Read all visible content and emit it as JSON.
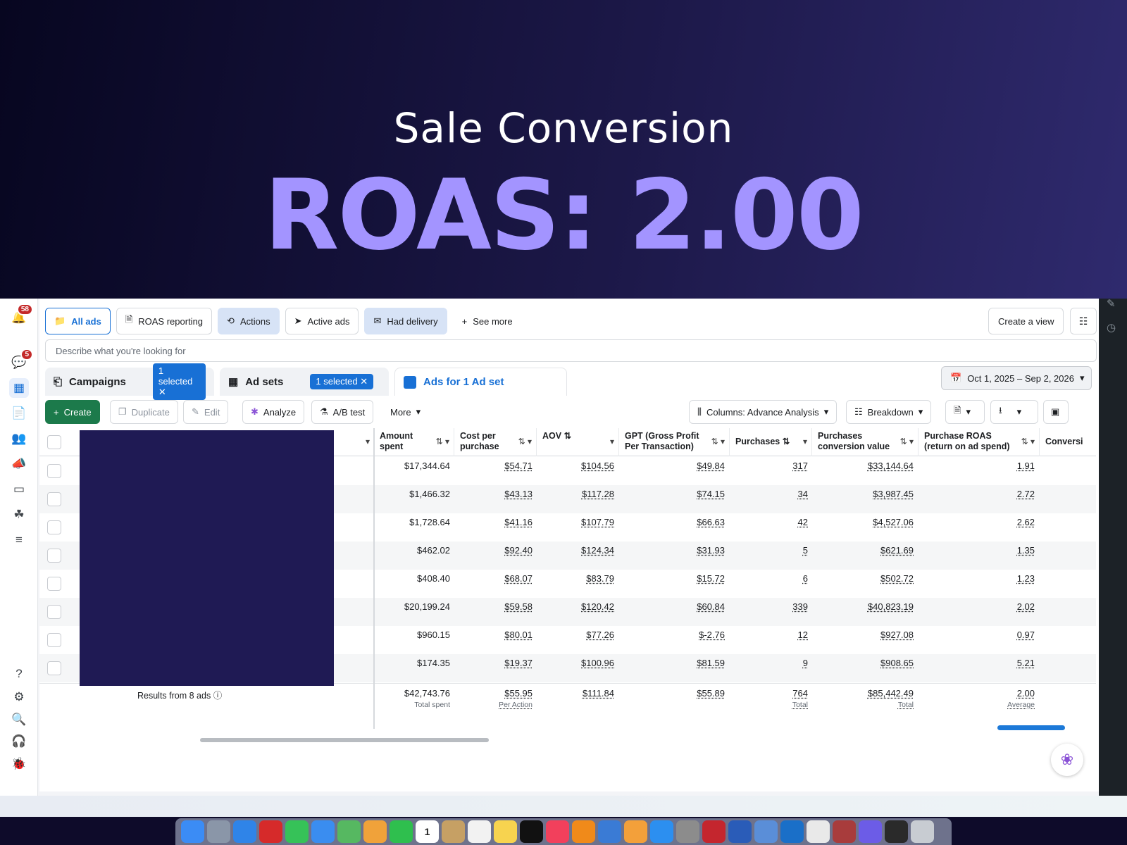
{
  "hero": {
    "subtitle": "Sale Conversion",
    "title": "ROAS: 2.00"
  },
  "leftnav": {
    "notifications_count": "58",
    "messages_count": "5",
    "items": [
      "bell-icon",
      "speech-icon",
      "table-icon",
      "pages-icon",
      "people-icon",
      "megaphone-icon",
      "card-icon",
      "network-icon",
      "menu-icon"
    ],
    "bottom": [
      "help-icon",
      "gear-icon",
      "search-icon",
      "headset-icon",
      "bug-icon"
    ]
  },
  "view_tabs": [
    {
      "label": "All ads",
      "icon": "folder-icon"
    },
    {
      "label": "ROAS reporting",
      "icon": "report-icon"
    },
    {
      "label": "Actions",
      "icon": "actions-icon"
    },
    {
      "label": "Active ads",
      "icon": "send-icon"
    },
    {
      "label": "Had delivery",
      "icon": "envelope-icon"
    },
    {
      "label": "See more",
      "icon": "plus-icon"
    }
  ],
  "create_view_label": "Create a view",
  "search_placeholder": "Describe what you're looking for",
  "levels": {
    "campaigns": {
      "label": "Campaigns",
      "selected": "1 selected"
    },
    "adsets": {
      "label": "Ad sets",
      "selected": "1 selected"
    },
    "ads": {
      "label": "Ads for 1 Ad set"
    }
  },
  "date_range": "Oct 1, 2025 – Sep 2, 2026",
  "toolbar": {
    "create": "Create",
    "duplicate": "Duplicate",
    "edit": "Edit",
    "analyze": "Analyze",
    "ab_test": "A/B test",
    "more": "More",
    "columns": "Columns: Advance Analysis",
    "breakdown": "Breakdown"
  },
  "columns": [
    {
      "line1": "Amount",
      "line2": "spent"
    },
    {
      "line1": "Cost per",
      "line2": "purchase"
    },
    {
      "line1": "AOV",
      "line2": ""
    },
    {
      "line1": "GPT (Gross Profit",
      "line2": "Per Transaction)"
    },
    {
      "line1": "Purchases",
      "line2": ""
    },
    {
      "line1": "Purchases",
      "line2": "conversion value"
    },
    {
      "line1": "Purchase ROAS",
      "line2": "(return on ad spend)"
    },
    {
      "line1": "Conversi",
      "line2": ""
    }
  ],
  "rows": [
    [
      "$17,344.64",
      "$54.71",
      "$104.56",
      "$49.84",
      "317",
      "$33,144.64",
      "1.91"
    ],
    [
      "$1,466.32",
      "$43.13",
      "$117.28",
      "$74.15",
      "34",
      "$3,987.45",
      "2.72"
    ],
    [
      "$1,728.64",
      "$41.16",
      "$107.79",
      "$66.63",
      "42",
      "$4,527.06",
      "2.62"
    ],
    [
      "$462.02",
      "$92.40",
      "$124.34",
      "$31.93",
      "5",
      "$621.69",
      "1.35"
    ],
    [
      "$408.40",
      "$68.07",
      "$83.79",
      "$15.72",
      "6",
      "$502.72",
      "1.23"
    ],
    [
      "$20,199.24",
      "$59.58",
      "$120.42",
      "$60.84",
      "339",
      "$40,823.19",
      "2.02"
    ],
    [
      "$960.15",
      "$80.01",
      "$77.26",
      "$-2.76",
      "12",
      "$927.08",
      "0.97"
    ],
    [
      "$174.35",
      "$19.37",
      "$100.96",
      "$81.59",
      "9",
      "$908.65",
      "5.21"
    ]
  ],
  "totals": {
    "label": "Results from 8 ads",
    "values": [
      "$42,743.76",
      "$55.95",
      "$111.84",
      "$55.89",
      "764",
      "$85,442.49",
      "2.00"
    ],
    "subs": [
      "Total spent",
      "Per Action",
      "",
      "",
      "Total",
      "Total",
      "Average"
    ]
  },
  "dock": [
    "Finder",
    "Launchpad",
    "Safari",
    "Opera",
    "Messages",
    "Mail",
    "Maps",
    "Photos",
    "FaceTime",
    "Calendar",
    "Contacts",
    "Reminders",
    "Notes",
    "TV",
    "Music",
    "VLC",
    "Keynote",
    "Pages",
    "App Store",
    "System Settings",
    "Acrobat",
    "Word",
    "Preview",
    "Outlook",
    "Chrome",
    "Dictionary",
    "Chrome Helper",
    "Archive",
    "Trash"
  ],
  "dock_calendar_day": "1"
}
